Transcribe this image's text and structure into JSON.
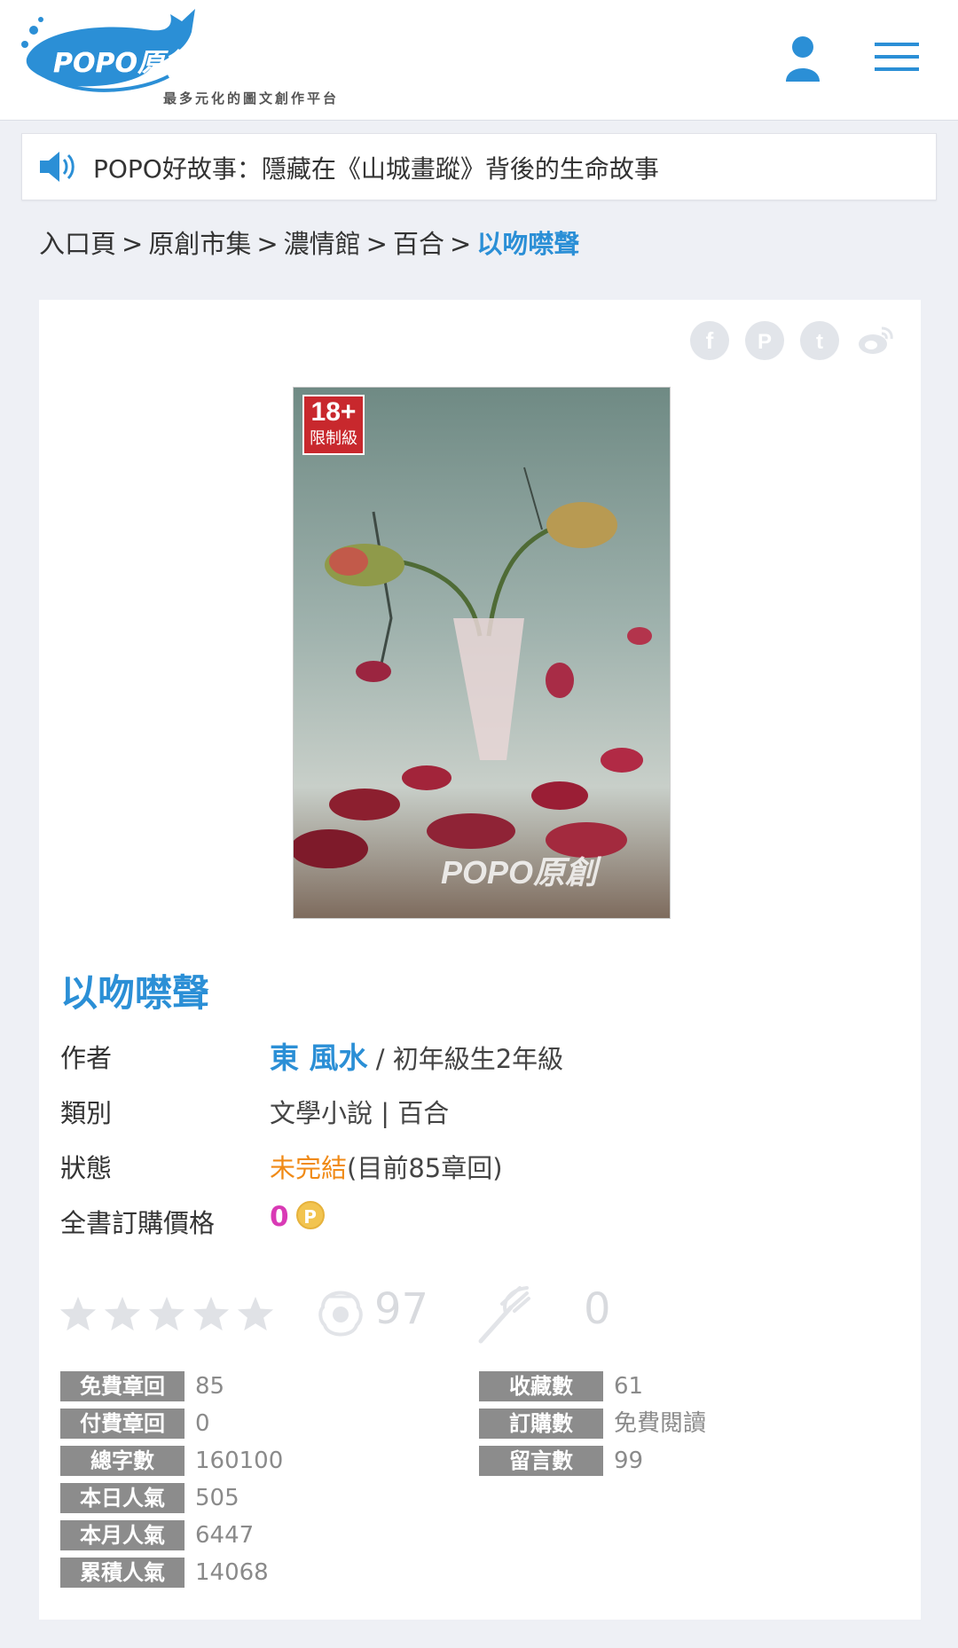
{
  "header": {
    "logo_text": "POPO原創市集",
    "logo_slogan": "最多元化的圖文創作平台"
  },
  "announcement": {
    "text": "POPO好故事：隱藏在《山城畫蹤》背後的生命故事"
  },
  "breadcrumb": {
    "items": [
      "入口頁",
      "原創市集",
      "濃情館",
      "百合"
    ],
    "separator": ">",
    "current": "以吻噤聲"
  },
  "share": {
    "icons": [
      "facebook-icon",
      "popo-share-icon",
      "tumblr-icon",
      "weibo-icon"
    ]
  },
  "cover": {
    "age_badge_top": "18+",
    "age_badge_bottom": "限制級",
    "watermark": "POPO原創"
  },
  "book": {
    "title": "以吻噤聲",
    "author_label": "作者",
    "author_name": "東 風水",
    "author_level": "/ 初年級生2年級",
    "category_label": "類別",
    "category_value": "文學小說 | 百合",
    "status_label": "狀態",
    "status_value": "未完結",
    "status_detail": "(目前85章回)",
    "price_label": "全書訂購價格",
    "price_value": "0",
    "coin_symbol": "P"
  },
  "rating": {
    "stars_filled": 0,
    "stars_total": 5,
    "pearl_count": "97",
    "fork_count": "0"
  },
  "stats_left": [
    {
      "label": "免費章回",
      "value": "85"
    },
    {
      "label": "付費章回",
      "value": "0"
    },
    {
      "label": "總字數",
      "value": "160100"
    },
    {
      "label": "本日人氣",
      "value": "505"
    },
    {
      "label": "本月人氣",
      "value": "6447"
    },
    {
      "label": "累積人氣",
      "value": "14068"
    }
  ],
  "stats_right": [
    {
      "label": "收藏數",
      "value": "61"
    },
    {
      "label": "訂購數",
      "value": "免費閱讀"
    },
    {
      "label": "留言數",
      "value": "99"
    }
  ],
  "colors": {
    "accent": "#2b8fd6",
    "status": "#f08a16",
    "price": "#d93ab5",
    "tag_bg": "#8c8c8c"
  }
}
